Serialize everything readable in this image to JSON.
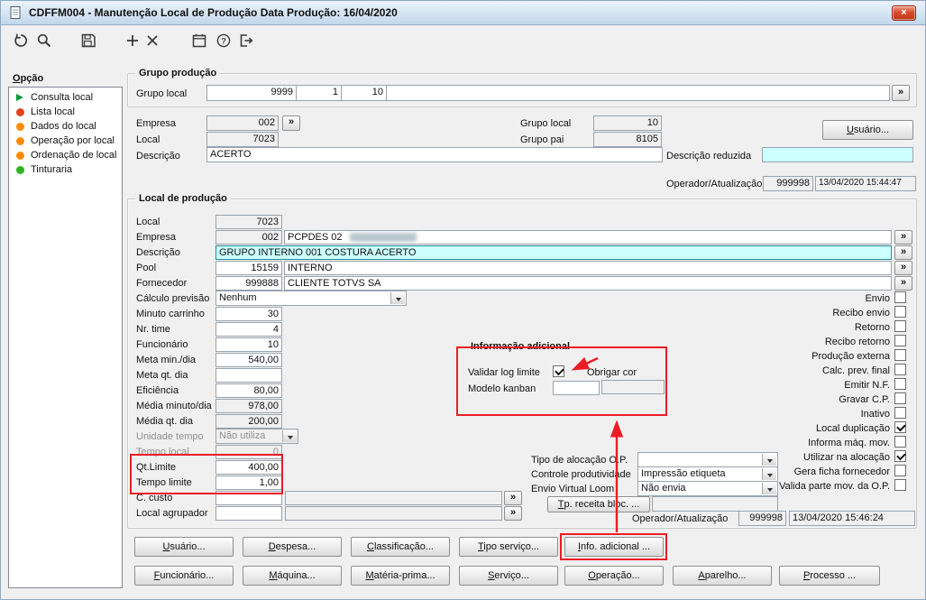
{
  "window": {
    "title": "CDFFM004 - Manutenção Local de Produção Data Produção: 16/04/2020",
    "close_label": "×"
  },
  "colors": {
    "annotation_red": "#ec1c24",
    "highlight_cyan": "#ccffff",
    "titlebar_blue": "#c3d8ec"
  },
  "ui": {
    "zoom_label": "»"
  },
  "toolbar": {
    "icons": [
      "undo",
      "search",
      "save",
      "add",
      "delete",
      "calendar",
      "help",
      "exit"
    ]
  },
  "sidebar": {
    "title": "Opção",
    "items": [
      {
        "label": "Consulta local",
        "marker": "green-arrow"
      },
      {
        "label": "Lista local",
        "marker": "red-dot"
      },
      {
        "label": "Dados do local",
        "marker": "orange-dot"
      },
      {
        "label": "Operação por local",
        "marker": "orange-dot"
      },
      {
        "label": "Ordenação de local",
        "marker": "orange-dot"
      },
      {
        "label": "Tinturaria",
        "marker": "green-dot"
      }
    ]
  },
  "grupo_producao": {
    "title": "Grupo produção",
    "grupo_local_label": "Grupo local",
    "grupo_local_1": "9999",
    "grupo_local_2": "1",
    "grupo_local_3": "10",
    "grupo_local_4": ""
  },
  "header": {
    "empresa_label": "Empresa",
    "empresa": "002",
    "local_label": "Local",
    "local": "7023",
    "grupo_local_label": "Grupo local",
    "grupo_local": "10",
    "grupo_pai_label": "Grupo pai",
    "grupo_pai": "8105",
    "usuario_button": "Usuário...",
    "descricao_label": "Descrição",
    "descricao": "ACERTO",
    "descricao_reduzida_label": "Descrição reduzida",
    "descricao_reduzida": "",
    "operador_label": "Operador/Atualização",
    "operador": "999998",
    "atualizacao": "13/04/2020 15:44:47"
  },
  "local_producao": {
    "title": "Local de produção",
    "local": {
      "label": "Local",
      "value": "7023"
    },
    "empresa": {
      "label": "Empresa",
      "value": "002",
      "descricao": "PCPDES 02"
    },
    "descricao": {
      "label": "Descrição",
      "value": "GRUPO INTERNO 001 COSTURA ACERTO"
    },
    "pool": {
      "label": "Pool",
      "value": "15159",
      "descricao": "INTERNO"
    },
    "fornecedor": {
      "label": "Fornecedor",
      "value": "999888",
      "descricao": "CLIENTE TOTVS SA"
    },
    "calculo_previsao": {
      "label": "Cálculo previsão",
      "value": "Nenhum"
    },
    "minuto_carrinho": {
      "label": "Minuto carrinho",
      "value": "30"
    },
    "nr_time": {
      "label": "Nr. time",
      "value": "4"
    },
    "funcionario": {
      "label": "Funcionário",
      "value": "10"
    },
    "meta_min_dia": {
      "label": "Meta min./dia",
      "value": "540,00"
    },
    "meta_qt_dia": {
      "label": "Meta qt. dia",
      "value": ""
    },
    "eficiencia": {
      "label": "Eficiência",
      "value": "80,00"
    },
    "media_minuto_dia": {
      "label": "Média minuto/dia",
      "value": "978,00"
    },
    "media_qt_dia": {
      "label": "Média qt. dia",
      "value": "200,00"
    },
    "unidade_tempo": {
      "label": "Unidade tempo",
      "value": "Não utiliza"
    },
    "tempo_local": {
      "label": "Tempo local",
      "value": "0"
    },
    "qt_limite": {
      "label": "Qt.Limite",
      "value": "400,00"
    },
    "tempo_limite": {
      "label": "Tempo limite",
      "value": "1,00"
    },
    "c_custo": {
      "label": "C. custo",
      "value": "",
      "descricao": ""
    },
    "local_agrupador": {
      "label": "Local agrupador",
      "value": "",
      "descricao": ""
    }
  },
  "info_adicional": {
    "title": "Informação adicional",
    "validar_log_limite": {
      "label": "Validar log limite",
      "checked": true
    },
    "obrigar_cor": {
      "label": "Obrigar cor",
      "value": ""
    },
    "modelo_kanban": {
      "label": "Modelo kanban",
      "value": ""
    }
  },
  "flags": [
    {
      "label": "Envio",
      "checked": false
    },
    {
      "label": "Recibo envio",
      "checked": false
    },
    {
      "label": "Retorno",
      "checked": false
    },
    {
      "label": "Recibo retorno",
      "checked": false
    },
    {
      "label": "Produção externa",
      "checked": false
    },
    {
      "label": "Calc. prev. final",
      "checked": false
    },
    {
      "label": "Emitir N.F.",
      "checked": false
    },
    {
      "label": "Gravar C.P.",
      "checked": false
    },
    {
      "label": "Inativo",
      "checked": false
    },
    {
      "label": "Local duplicação",
      "checked": true
    },
    {
      "label": "Informa máq. mov.",
      "checked": false
    },
    {
      "label": "Utilizar na alocação",
      "checked": true
    },
    {
      "label": "Gera ficha fornecedor",
      "checked": false
    },
    {
      "label": "Valida parte mov. da O.P.",
      "checked": false
    }
  ],
  "alocacao": {
    "tipo_label": "Tipo de alocação O.P.",
    "tipo_value": "",
    "controle_label": "Controle produtividade",
    "controle_value": "Impressão etiqueta",
    "envio_label": "Envio Virtual Loom",
    "envio_value": "Não envia",
    "tp_receita_button": "Tp. receita bloc. ...",
    "operador_label": "Operador/Atualização",
    "operador": "999998",
    "atualizacao": "13/04/2020 15:46:24"
  },
  "actions": {
    "row1": [
      "Usuário...",
      "Despesa...",
      "Classificação...",
      "Tipo serviço...",
      "Info. adicional ..."
    ],
    "row2": [
      "Funcionário...",
      "Máquina...",
      "Matéria-prima...",
      "Serviço...",
      "Operação...",
      "Aparelho...",
      "Processo ..."
    ]
  }
}
